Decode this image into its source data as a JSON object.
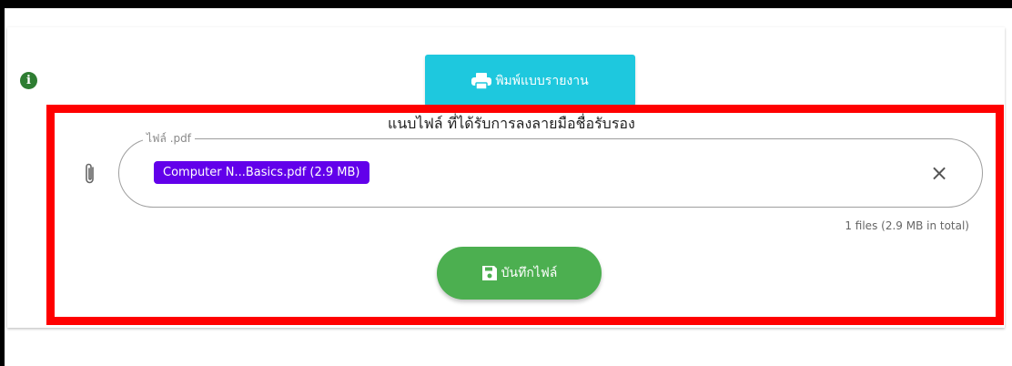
{
  "print_button": {
    "label": "พิมพ์แบบรายงาน",
    "icon": "printer-icon",
    "color": "#1ec8de"
  },
  "info_icon": {
    "icon": "info-icon",
    "glyph": "i",
    "color": "#2e7d32"
  },
  "upload": {
    "title": "แนบไฟล์ ที่ได้รับการลงลายมือชื่อรับรอง",
    "field_label": "ไฟล์ .pdf",
    "attach_icon": "paperclip-icon",
    "file_chip": "Computer N...Basics.pdf (2.9 MB)",
    "chip_color": "#6200ea",
    "clear_glyph": "×",
    "summary": "1 files (2.9 MB in total)"
  },
  "save_button": {
    "label": "บันทึกไฟล์",
    "icon": "floppy-disk-icon",
    "color": "#4caf50"
  },
  "highlight_color": "#ff0000"
}
